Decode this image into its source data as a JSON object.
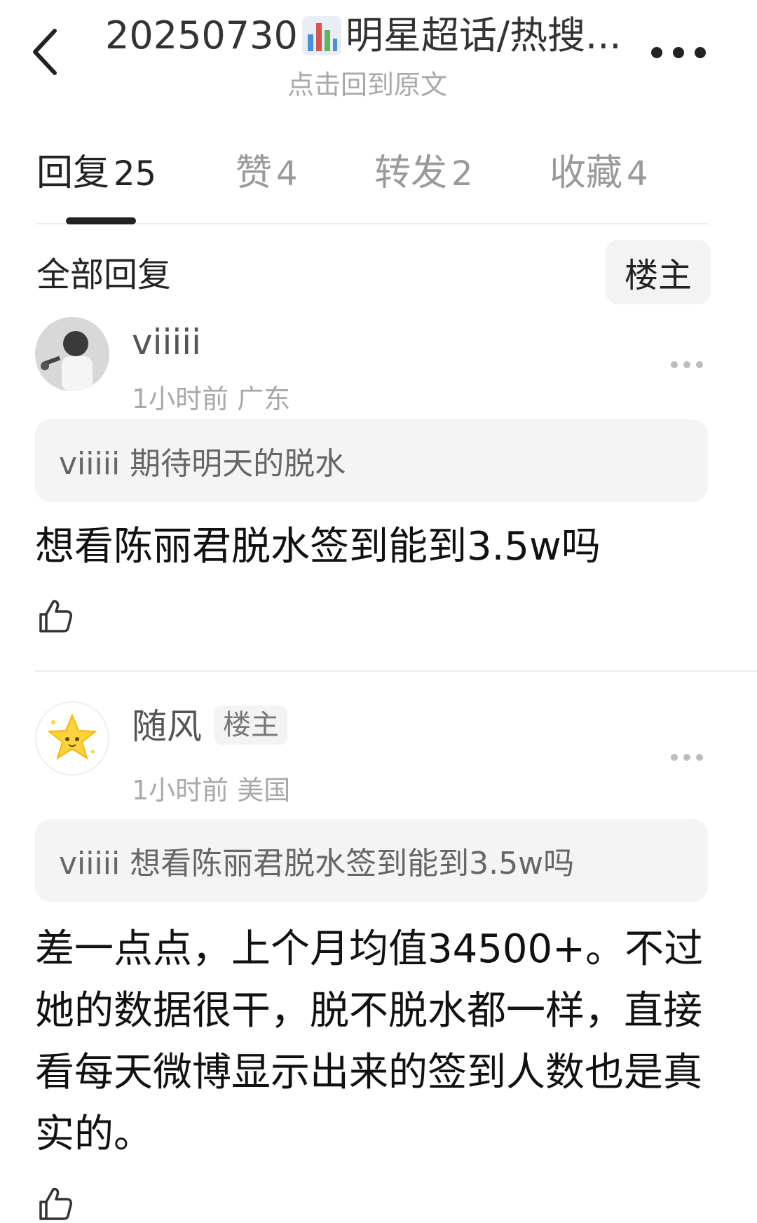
{
  "header": {
    "title_prefix": "20250730",
    "title_suffix": "明星超话/热搜...",
    "subtitle": "点击回到原文",
    "icons": {
      "back": "back-chevron-icon",
      "chart": "bar-chart-icon",
      "more": "more-icon"
    }
  },
  "tabs": [
    {
      "label": "回复",
      "count": "25",
      "active": true
    },
    {
      "label": "赞",
      "count": "4"
    },
    {
      "label": "转发",
      "count": "2"
    },
    {
      "label": "收藏",
      "count": "4"
    }
  ],
  "section": {
    "title": "全部回复",
    "filter_button": "楼主"
  },
  "comments": [
    {
      "username": "viiiii",
      "time": "1小时前",
      "location": "广东",
      "quote": "viiiii 期待明天的脱水",
      "text": "想看陈丽君脱水签到能到3.5w吗"
    },
    {
      "username": "随风",
      "badge": "楼主",
      "time": "1小时前",
      "location": "美国",
      "quote": "viiiii 想看陈丽君脱水签到能到3.5w吗",
      "text": "差一点点，上个月均值34500+。不过她的数据很干，脱不脱水都一样，直接看每天微博显示出来的签到人数也是真实的。"
    }
  ],
  "colors": {
    "active": "#222222",
    "inactive": "#9a9a9a",
    "quote_bg": "#f4f4f4"
  }
}
